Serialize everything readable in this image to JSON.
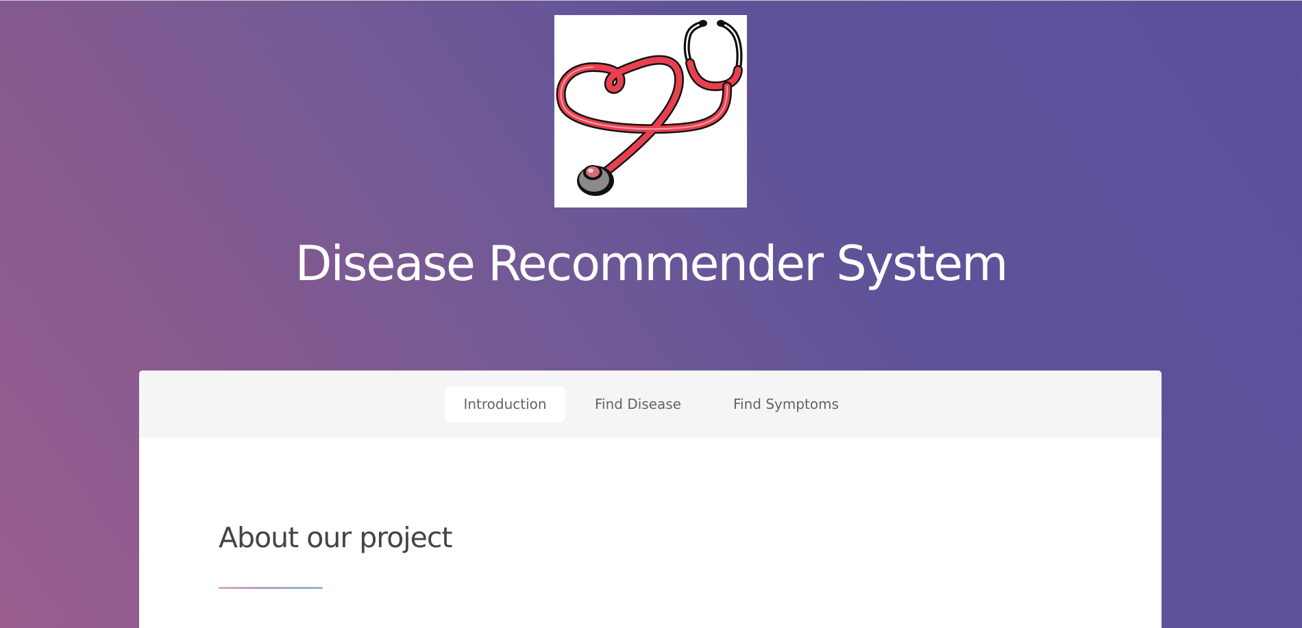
{
  "header": {
    "logo_icon": "stethoscope-heart-icon",
    "title": "Disease Recommender System"
  },
  "tabs": [
    {
      "label": "Introduction",
      "active": true
    },
    {
      "label": "Find Disease",
      "active": false
    },
    {
      "label": "Find Symptoms",
      "active": false
    }
  ],
  "content": {
    "heading": "About our project"
  },
  "colors": {
    "background_gradient_start": "#9a5f8f",
    "background_gradient_end": "#5a509a",
    "card": "#ffffff",
    "tab_bar": "#f5f5f5",
    "stethoscope_tube": "#e8404f",
    "underline_start": "#e8a6b9",
    "underline_end": "#8eb7e8"
  }
}
